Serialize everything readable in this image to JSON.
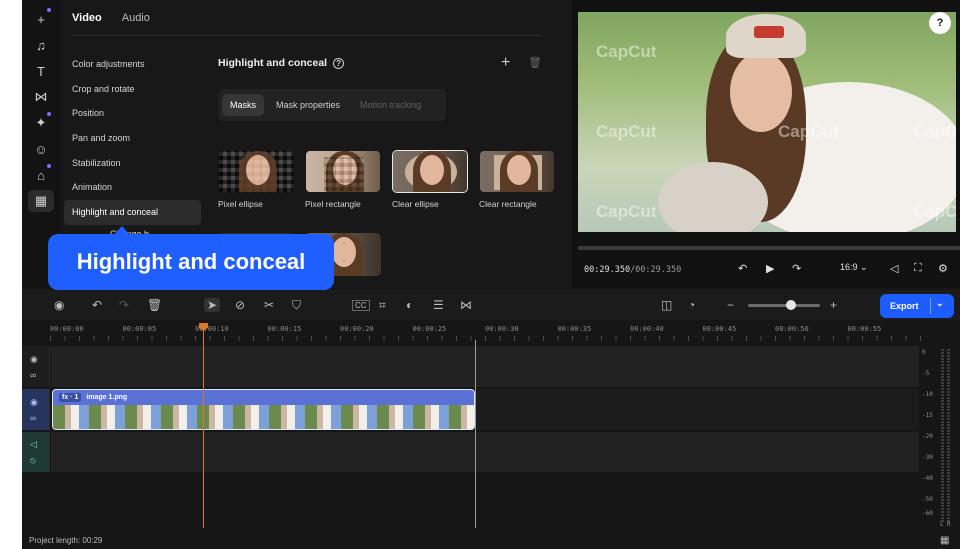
{
  "toolbar": {
    "items": [
      {
        "icon": "plus-icon",
        "glyph": "+"
      },
      {
        "icon": "music-icon",
        "glyph": "♫"
      },
      {
        "icon": "text-icon",
        "glyph": "T"
      },
      {
        "icon": "transition-icon",
        "glyph": "⋈"
      },
      {
        "icon": "effects-wand-icon",
        "glyph": "✦"
      },
      {
        "icon": "sticker-icon",
        "glyph": "☺"
      },
      {
        "icon": "templates-bag-icon",
        "glyph": "⌂"
      },
      {
        "icon": "apps-grid-icon",
        "glyph": "▦"
      }
    ]
  },
  "props": {
    "tabs": [
      "Video",
      "Audio"
    ],
    "menu": [
      "Color adjustments",
      "Crop and rotate",
      "Position",
      "Pan and zoom",
      "Stabilization",
      "Animation",
      "Highlight and conceal"
    ],
    "menu_partial": "Change b",
    "section_title": "Highlight and conceal",
    "subtabs": [
      "Masks",
      "Mask properties",
      "Motion tracking"
    ],
    "masks": [
      "Pixel ellipse",
      "Pixel rectangle",
      "Clear ellipse",
      "Clear rectangle"
    ]
  },
  "callout": {
    "text": "Highlight and conceal"
  },
  "preview": {
    "watermark": "CapCut",
    "timecode_current": "00:29.350",
    "timecode_total": "/00:29.350",
    "aspect": "16:9"
  },
  "timeline": {
    "ruler": [
      "00:00:00",
      "00:00:05",
      "00:00:10",
      "00:00:15",
      "00:00:20",
      "00:00:25",
      "00:00:30",
      "00:00:35",
      "00:00:40",
      "00:00:45",
      "00:00:50",
      "00:00:55"
    ],
    "clip": {
      "fx": "fx · 1",
      "name": "image 1.png"
    },
    "export_label": "Export",
    "meter_labels": [
      "0",
      "-5",
      "-10",
      "-15",
      "-20",
      "-30",
      "-40",
      "-50",
      "-60"
    ],
    "meter_channels": [
      "L",
      "R"
    ]
  },
  "status": {
    "project_length": "Project length: 00:29"
  },
  "colors": {
    "accent": "#1f5fff",
    "playhead": "#d9782a",
    "clip": "#5a72d6"
  }
}
